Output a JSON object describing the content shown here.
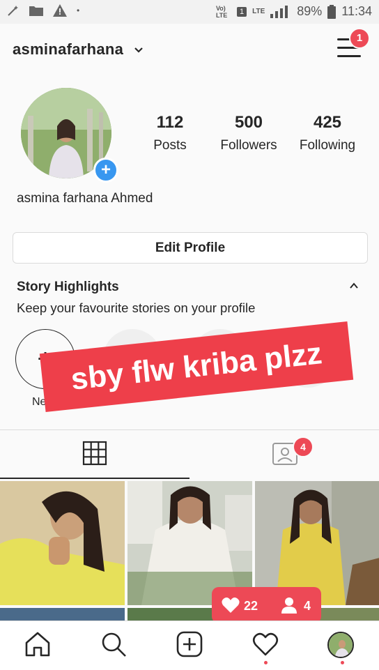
{
  "status_bar": {
    "volte": "Vo) LTE",
    "sim": "1",
    "lte": "LTE",
    "battery": "89%",
    "time": "11:34"
  },
  "header": {
    "username": "asminafarhana",
    "menu_badge": "1"
  },
  "profile": {
    "stats": [
      {
        "value": "112",
        "label": "Posts"
      },
      {
        "value": "500",
        "label": "Followers"
      },
      {
        "value": "425",
        "label": "Following"
      }
    ],
    "full_name": "asmina farhana Ahmed",
    "edit_label": "Edit Profile"
  },
  "highlights": {
    "title": "Story Highlights",
    "subtitle": "Keep your favourite stories on your profile",
    "new_label": "Ne"
  },
  "banner": {
    "text": "sby flw kriba plzz"
  },
  "tabs": {
    "tagged_badge": "4"
  },
  "activity_popup": {
    "likes": "22",
    "follows": "4"
  },
  "colors": {
    "accent": "#ed4956",
    "blue": "#3897f0"
  }
}
